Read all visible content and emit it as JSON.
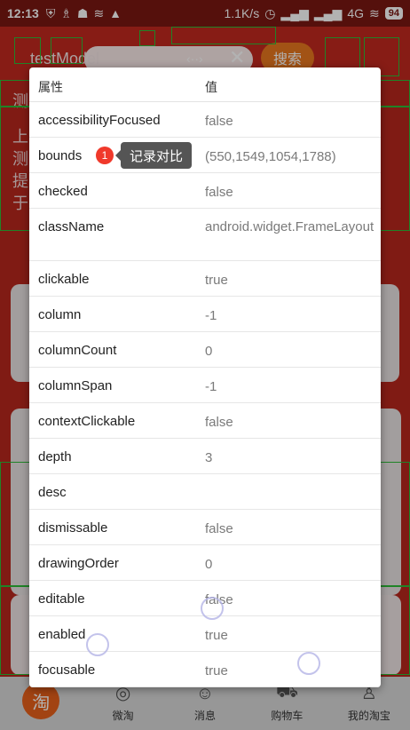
{
  "status_bar": {
    "time": "12:13",
    "net_speed": "1.1K/s",
    "network": "4G",
    "battery": "94"
  },
  "background": {
    "title": "testModel",
    "search_button": "搜索",
    "code_glyph": "‹··›",
    "close_glyph": "✕",
    "left_texts": [
      "测",
      "上",
      "测",
      "提",
      "于"
    ],
    "bottom_tabs": [
      {
        "label": "",
        "icon": "淘"
      },
      {
        "label": "微淘",
        "icon": "◎"
      },
      {
        "label": "消息",
        "icon": "☺"
      },
      {
        "label": "购物车",
        "icon": "⛟"
      },
      {
        "label": "我的淘宝",
        "icon": "♙"
      }
    ]
  },
  "dialog": {
    "header_key": "属性",
    "header_value": "值",
    "rows": [
      {
        "key": "accessibilityFocused",
        "value": "false"
      },
      {
        "key": "bounds",
        "value": "(550,1549,1054,1788)"
      },
      {
        "key": "checked",
        "value": "false"
      },
      {
        "key": "className",
        "value": "android.widget.FrameLayout"
      },
      {
        "key": "clickable",
        "value": "true"
      },
      {
        "key": "column",
        "value": "-1"
      },
      {
        "key": "columnCount",
        "value": "0"
      },
      {
        "key": "columnSpan",
        "value": "-1"
      },
      {
        "key": "contextClickable",
        "value": "false"
      },
      {
        "key": "depth",
        "value": "3"
      },
      {
        "key": "desc",
        "value": ""
      },
      {
        "key": "dismissable",
        "value": "false"
      },
      {
        "key": "drawingOrder",
        "value": "0"
      },
      {
        "key": "editable",
        "value": "false"
      },
      {
        "key": "enabled",
        "value": "true"
      },
      {
        "key": "focusable",
        "value": "true"
      }
    ]
  },
  "tooltip": {
    "badge": "1",
    "label": "记录对比"
  },
  "colors": {
    "accent_red": "#f0392b",
    "header_red": "#c2291f",
    "value_gray": "#7a7a7a"
  }
}
